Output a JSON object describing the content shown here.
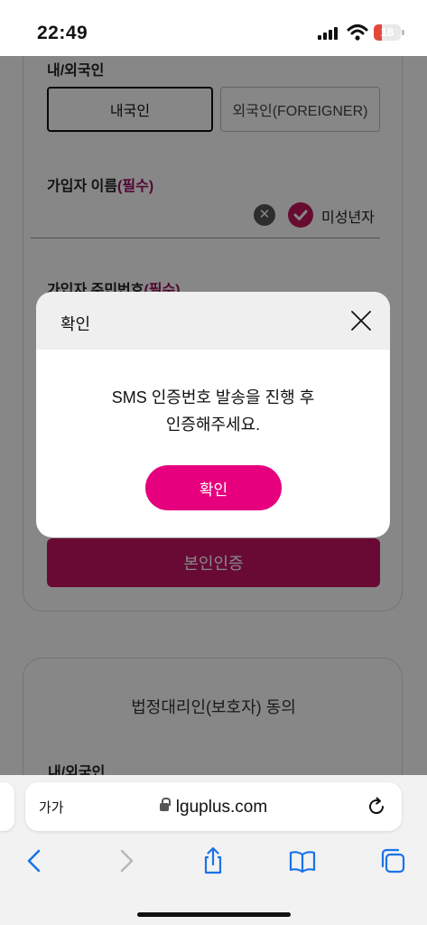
{
  "status_bar": {
    "time": "22:49",
    "battery": "18"
  },
  "form": {
    "nationality_label": "내/외국인",
    "nationality_options": [
      "내국인",
      "외국인(FOREIGNER)"
    ],
    "name_label": "가입자 이름",
    "required_tag": "(필수)",
    "minor_label": "미성년자",
    "id_label": "가입자 주민번호",
    "verify_button": "본인인증"
  },
  "guardian": {
    "title": "법정대리인(보호자) 동의",
    "nationality_label": "내/외국인"
  },
  "modal": {
    "title": "확인",
    "message_line1": "SMS 인증번호 발송을 진행 후",
    "message_line2": "인증해주세요.",
    "ok_button": "확인"
  },
  "browser": {
    "text_size_button": "가가",
    "url": "lguplus.com"
  },
  "colors": {
    "brand_magenta": "#e6007e",
    "verify_button": "#c41462",
    "required_text": "#9c0f5f"
  }
}
